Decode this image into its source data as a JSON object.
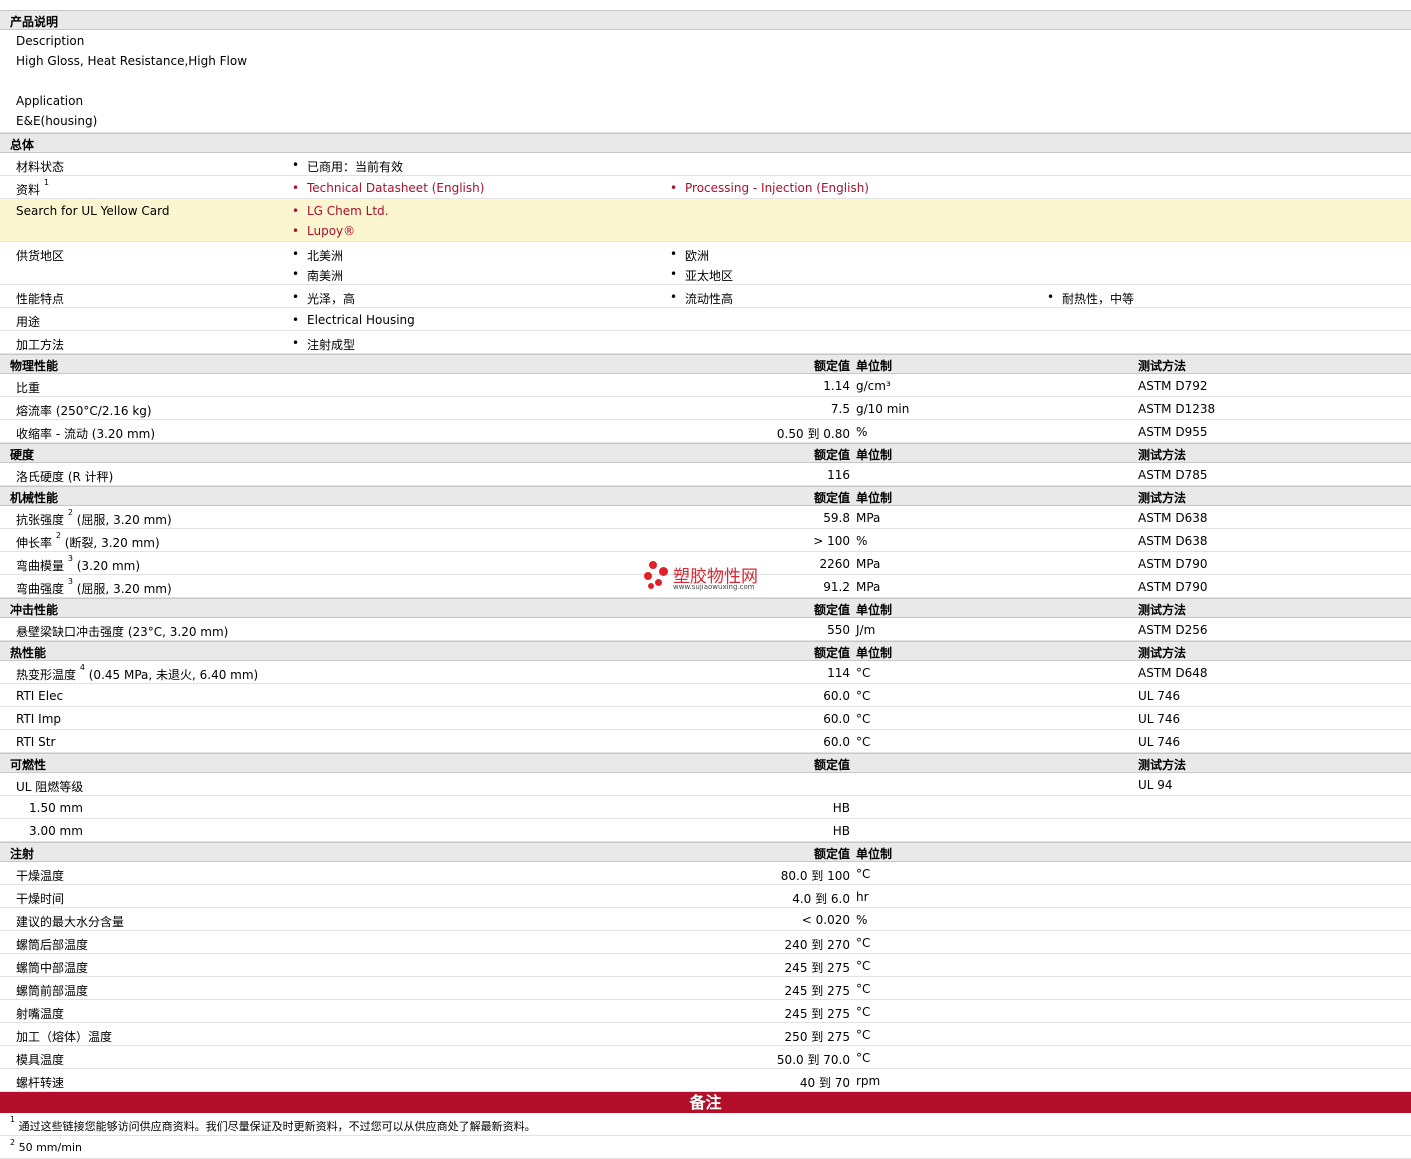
{
  "sections": {
    "product": "产品说明",
    "general": "总体",
    "physical": "物理性能",
    "hardness": "硬度",
    "mechanical": "机械性能",
    "impact": "冲击性能",
    "thermal": "热性能",
    "flammability": "可燃性",
    "injection": "注射"
  },
  "headers": {
    "value": "额定值",
    "unit": "单位制",
    "method": "测试方法"
  },
  "description": {
    "desc_label": "Description",
    "desc_value": "High Gloss, Heat Resistance,High Flow",
    "app_label": "Application",
    "app_value": "E&E(housing)"
  },
  "general": {
    "status_label": "材料状态",
    "status_value": "已商用：当前有效",
    "docs_label": "资料",
    "docs_sup": "1",
    "doc1": "Technical Datasheet (English)",
    "doc2": "Processing - Injection (English)",
    "ul_label": "Search for UL Yellow Card",
    "ul1": "LG Chem Ltd.",
    "ul2": "Lupoy®",
    "region_label": "供货地区",
    "region1": "北美洲",
    "region2": "欧洲",
    "region3": "南美洲",
    "region4": "亚太地区",
    "feature_label": "性能特点",
    "feature1": "光泽，高",
    "feature2": "流动性高",
    "feature3": "耐热性，中等",
    "use_label": "用途",
    "use1": "Electrical Housing",
    "proc_label": "加工方法",
    "proc1": "注射成型"
  },
  "physical": [
    {
      "label": "比重",
      "value": "1.14",
      "unit": "g/cm³",
      "method": "ASTM D792"
    },
    {
      "label": "熔流率  (250°C/2.16 kg)",
      "value": "7.5",
      "unit": "g/10 min",
      "method": "ASTM D1238"
    },
    {
      "label": "收缩率  - 流动  (3.20 mm)",
      "value": "0.50 到  0.80",
      "unit": "%",
      "method": "ASTM D955"
    }
  ],
  "hardness": [
    {
      "label": "洛氏硬度  (R 计秤)",
      "value": "116",
      "unit": "",
      "method": "ASTM D785"
    }
  ],
  "mechanical": [
    {
      "label": "抗张强度",
      "sup": "2",
      "rest": " (屈服, 3.20 mm)",
      "value": "59.8",
      "unit": "MPa",
      "method": "ASTM D638"
    },
    {
      "label": "伸长率",
      "sup": "2",
      "rest": " (断裂, 3.20 mm)",
      "value": "> 100",
      "unit": "%",
      "method": "ASTM D638"
    },
    {
      "label": "弯曲模量",
      "sup": "3",
      "rest": " (3.20 mm)",
      "value": "2260",
      "unit": "MPa",
      "method": "ASTM D790"
    },
    {
      "label": "弯曲强度",
      "sup": "3",
      "rest": " (屈服, 3.20 mm)",
      "value": "91.2",
      "unit": "MPa",
      "method": "ASTM D790"
    }
  ],
  "impact": [
    {
      "label": "悬壁梁缺口冲击强度  (23°C, 3.20 mm)",
      "value": "550",
      "unit": "J/m",
      "method": "ASTM D256"
    }
  ],
  "thermal": [
    {
      "label": "热变形温度",
      "sup": "4",
      "rest": " (0.45 MPa, 未退火, 6.40 mm)",
      "value": "114",
      "unit": "°C",
      "method": "ASTM D648"
    },
    {
      "label": "RTI Elec",
      "value": "60.0",
      "unit": "°C",
      "method": "UL 746"
    },
    {
      "label": "RTI Imp",
      "value": "60.0",
      "unit": "°C",
      "method": "UL 746"
    },
    {
      "label": "RTI Str",
      "value": "60.0",
      "unit": "°C",
      "method": "UL 746"
    }
  ],
  "flammability": {
    "label": "UL 阻燃等级",
    "method": "UL 94",
    "rows": [
      {
        "label": "1.50 mm",
        "value": "HB"
      },
      {
        "label": "3.00 mm",
        "value": "HB"
      }
    ]
  },
  "injection": [
    {
      "label": "干燥温度",
      "value": "80.0 到  100",
      "unit": "°C"
    },
    {
      "label": "干燥时间",
      "value": "4.0 到  6.0",
      "unit": "hr"
    },
    {
      "label": "建议的最大水分含量",
      "value": "< 0.020",
      "unit": "%"
    },
    {
      "label": "螺筒后部温度",
      "value": "240 到  270",
      "unit": "°C"
    },
    {
      "label": "螺筒中部温度",
      "value": "245 到  275",
      "unit": "°C"
    },
    {
      "label": "螺筒前部温度",
      "value": "245 到  275",
      "unit": "°C"
    },
    {
      "label": "射嘴温度",
      "value": "245 到  275",
      "unit": "°C"
    },
    {
      "label": "加工（熔体）温度",
      "value": "250 到  275",
      "unit": "°C"
    },
    {
      "label": "模具温度",
      "value": "50.0 到  70.0",
      "unit": "°C"
    },
    {
      "label": "螺杆转速",
      "value": "40 到  70",
      "unit": "rpm"
    }
  ],
  "notes": {
    "title": "备注",
    "n1_sup": "1",
    "n1": "通过这些链接您能够访问供应商资料。我们尽量保证及时更新资料，不过您可以从供应商处了解最新资料。",
    "n2_sup": "2",
    "n2": "50 mm/min"
  },
  "watermark": {
    "cn": "塑胶物性网",
    "en": "www.sujiaowuxing.com",
    "color": "#e0202a"
  },
  "colors": {
    "link": "#a8102e",
    "notes_bar": "#b30f2b",
    "highlight": "#fbf6cf",
    "section": "#e9e9e9"
  }
}
